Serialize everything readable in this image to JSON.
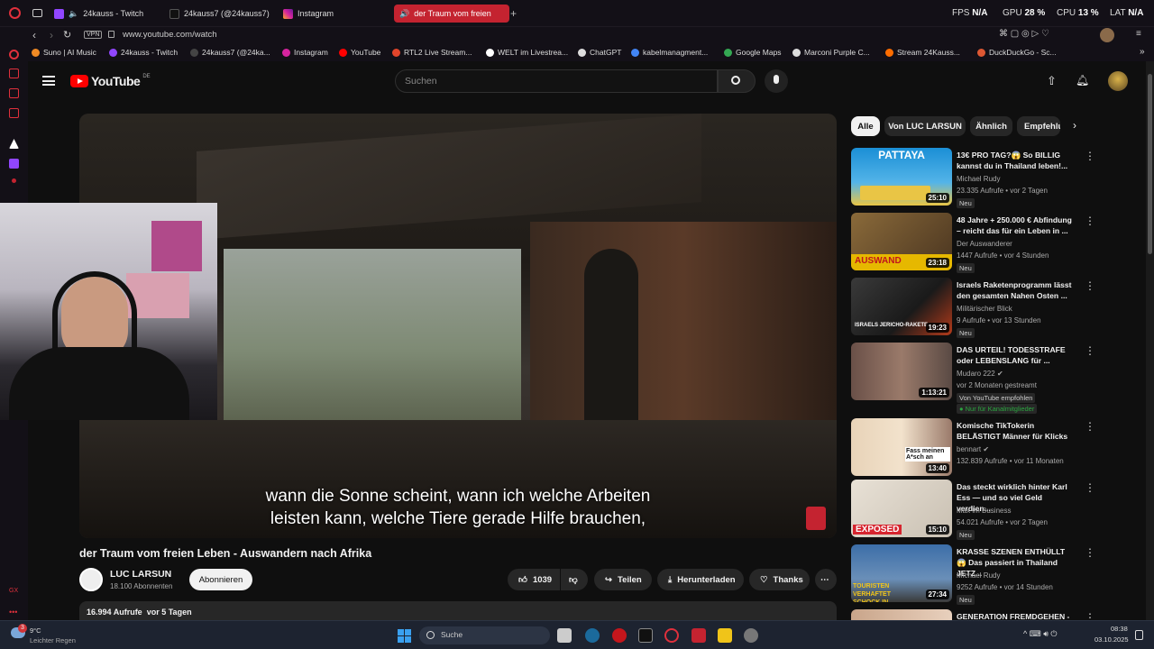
{
  "browser": {
    "tabs": [
      {
        "label": "24kauss - Twitch",
        "color": "#9146ff"
      },
      {
        "label": "24kauss7 (@24kauss7)",
        "color": "#111111"
      },
      {
        "label": "Instagram",
        "color": "#d6249f"
      },
      {
        "label": "der Traum vom freien",
        "color": "#ff0000"
      }
    ],
    "stats": [
      {
        "label": "FPS",
        "value": "N/A"
      },
      {
        "label": "GPU",
        "value": "28 %"
      },
      {
        "label": "CPU",
        "value": "13 %"
      },
      {
        "label": "LAT",
        "value": "N/A"
      }
    ],
    "vpn_label": "VPN",
    "url": "www.youtube.com/watch",
    "bookmarks": [
      {
        "label": "Suno | AI Music",
        "color": "#f08a24"
      },
      {
        "label": "24kauss - Twitch",
        "color": "#9146ff"
      },
      {
        "label": "24kauss7 (@24ka...",
        "color": "#222222"
      },
      {
        "label": "Instagram",
        "color": "#d6249f"
      },
      {
        "label": "YouTube",
        "color": "#ff0000"
      },
      {
        "label": "RTL2 Live Stream...",
        "color": "#e2452b"
      },
      {
        "label": "WELT im Livestrea...",
        "color": "#ffffff"
      },
      {
        "label": "ChatGPT",
        "color": "#dddddd"
      },
      {
        "label": "kabelmanagment...",
        "color": "#4285f4"
      },
      {
        "label": "Google Maps",
        "color": "#34a853"
      },
      {
        "label": "Marconi Purple C...",
        "color": "#dddddd"
      },
      {
        "label": "Stream 24Kauss...",
        "color": "#ff6d00"
      },
      {
        "label": "DuckDuckGo - Sc...",
        "color": "#de5833"
      }
    ]
  },
  "youtube": {
    "logo_text": "YouTube",
    "region": "DE",
    "search_placeholder": "Suchen",
    "video": {
      "subtitle_line1": "wann die Sonne scheint, wann ich welche Arbeiten",
      "subtitle_line2": "leisten kann, welche Tiere gerade Hilfe brauchen,",
      "title": "der Traum vom freien Leben - Auswandern nach Afrika",
      "channel": "LUC LARSUN",
      "subscribers": "18.100 Abonnenten",
      "subscribe_label": "Abonnieren",
      "likes": "1039",
      "share_label": "Teilen",
      "download_label": "Herunterladen",
      "thanks_label": "Thanks",
      "views": "16.994 Aufrufe",
      "age": "vor 5 Tagen"
    },
    "chips": [
      "Alle",
      "Von LUC LARSUN",
      "Ähnlich",
      "Empfehlu"
    ],
    "recommendations": [
      {
        "title": "13€ PRO TAG?😱 So BILLIG kannst du in Thailand leben!...",
        "channel": "Michael Rudy",
        "meta": "23.335 Aufrufe • vor 2 Tagen",
        "badge": "Neu",
        "duration": "25:10",
        "thumb_text": "PATTAYA",
        "thumb_color": "#1b8fd6",
        "thumb_color2": "#e9c545"
      },
      {
        "title": "48 Jahre + 250.000 € Abfindung – reicht das für ein Leben in ...",
        "channel": "Der Auswanderer",
        "meta": "1447 Aufrufe • vor 4 Stunden",
        "badge": "Neu",
        "duration": "23:18",
        "thumb_text": "AUSWAND",
        "thumb_color": "#6a4a2a",
        "thumb_color2": "#e6b800"
      },
      {
        "title": "Israels Raketenprogramm lässt den gesamten Nahen Osten ...",
        "channel": "Militärischer Blick",
        "meta": "9 Aufrufe • vor 13 Stunden",
        "badge": "Neu",
        "duration": "19:23",
        "thumb_text": "ISRAELS JERICHO-RAKETE",
        "thumb_color": "#2c2c2c",
        "thumb_color2": "#b33a1a"
      },
      {
        "title": "DAS URTEIL! TODESSTRAFE oder LEBENSLANG für ...",
        "channel": "Mudaro 222",
        "meta": "vor 2 Monaten gestreamt",
        "badge": "Von YouTube empfohlen",
        "badge2": "Nur für Kanalmitglieder",
        "duration": "1:13:21",
        "thumb_text": "",
        "thumb_color": "#5a4a44",
        "thumb_color2": "#8c6d60"
      },
      {
        "title": "Komische TikTokerin BELÄSTIGT Männer für Klicks",
        "channel": "bennart",
        "meta": "132.839 Aufrufe • vor 11 Monaten",
        "duration": "13:40",
        "thumb_text": "Fass meinen A*sch an",
        "thumb_color": "#d9c3a8",
        "thumb_color2": "#e74c3c"
      },
      {
        "title": "Das steckt wirklich hinter Karl Ess — und so viel Geld verdien...",
        "channel": "Max im Business",
        "meta": "54.021 Aufrufe • vor 2 Tagen",
        "badge": "Neu",
        "duration": "15:10",
        "thumb_text": "EXPOSED",
        "thumb_color": "#e8e1d6",
        "thumb_color2": "#d6252f"
      },
      {
        "title": "KRASSE SZENEN ENTHÜLLT😱 Das passiert in Thailand JETZ...",
        "channel": "Michael Rudy",
        "meta": "9252 Aufrufe • vor 14 Stunden",
        "badge": "Neu",
        "duration": "27:34",
        "thumb_text": "TOURISTEN VERHAFTET SCHOCK IN THAILAND",
        "thumb_color": "#3c6ea8",
        "thumb_color2": "#f0c419"
      },
      {
        "title": "GENERATION FREMDGEHEN - ...",
        "channel": "",
        "meta": "",
        "duration": "",
        "thumb_text": "",
        "thumb_color": "#c9a58a",
        "thumb_color2": "#e8d0bd"
      }
    ]
  },
  "taskbar": {
    "weather_temp": "9°C",
    "weather_text": "Leichter Regen",
    "notif_count": "3",
    "search_placeholder": "Suche",
    "time": "08:38",
    "date": "03.10.2025"
  }
}
